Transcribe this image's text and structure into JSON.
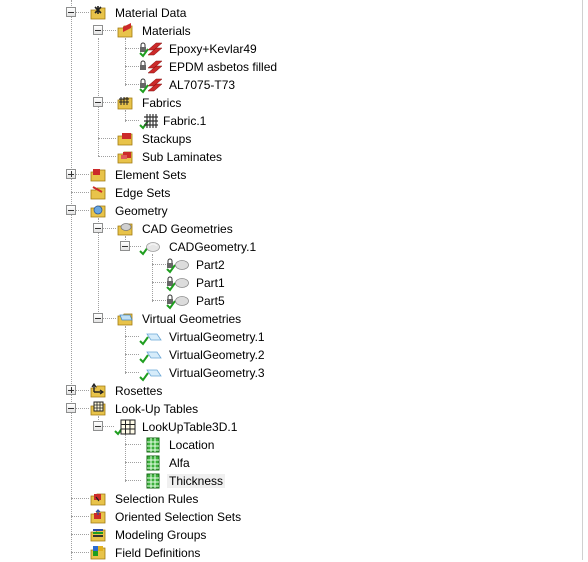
{
  "tree": {
    "material_data": "Material Data",
    "materials": "Materials",
    "material_items": [
      "Epoxy+Kevlar49",
      "EPDM asbetos filled",
      "AL7075-T73"
    ],
    "fabrics": "Fabrics",
    "fabric_item": "Fabric.1",
    "stackups": "Stackups",
    "sub_laminates": "Sub Laminates",
    "element_sets": "Element Sets",
    "edge_sets": "Edge Sets",
    "geometry": "Geometry",
    "cad_geometries": "CAD Geometries",
    "cad_geometry": "CADGeometry.1",
    "parts": [
      "Part2",
      "Part1",
      "Part5"
    ],
    "virtual_geometries": "Virtual Geometries",
    "virtual_items": [
      "VirtualGeometry.1",
      "VirtualGeometry.2",
      "VirtualGeometry.3"
    ],
    "rosettes": "Rosettes",
    "lookup_tables": "Look-Up Tables",
    "lookup_table": "LookUpTable3D.1",
    "lookup_items": [
      "Location",
      "Alfa",
      "Thickness"
    ],
    "selection_rules": "Selection Rules",
    "oriented_selection_sets": "Oriented Selection Sets",
    "modeling_groups": "Modeling Groups",
    "field_definitions": "Field Definitions"
  },
  "colors": {
    "folder": "#e8c34a",
    "tree_line": "#a0a0a0",
    "check": "#1f9e1f",
    "material_red": "#cc2a2a",
    "selection_bg": "#f0f0f0"
  }
}
